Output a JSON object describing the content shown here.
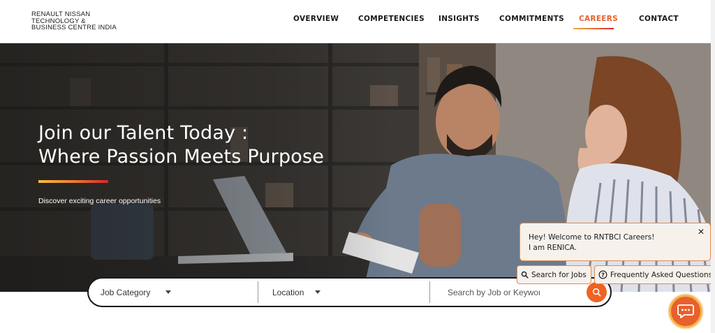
{
  "brand": {
    "line1": "RENAULT NISSAN",
    "line2": "TECHNOLOGY &",
    "line3": "BUSINESS CENTRE INDIA"
  },
  "nav": {
    "items": [
      {
        "label": "OVERVIEW"
      },
      {
        "label": "COMPETENCIES"
      },
      {
        "label": "INSIGHTS"
      },
      {
        "label": "COMMITMENTS"
      },
      {
        "label": "CAREERS",
        "active": true
      },
      {
        "label": "CONTACT"
      }
    ]
  },
  "hero": {
    "title_line1": "Join our Talent Today :",
    "title_line2": "Where Passion Meets Purpose",
    "subtitle": "Discover exciting career opportunities"
  },
  "search": {
    "category_label": "Job Category",
    "location_label": "Location",
    "keyword_placeholder": "Search by Job or Keyword",
    "button_icon": "search-icon"
  },
  "chat": {
    "message_line1": "Hey! Welcome to RNTBCI Careers!",
    "message_line2": "I am RENICA.",
    "close_symbol": "✕",
    "chip_jobs": "Search for Jobs",
    "chip_faq": "Frequently Asked Questions",
    "launcher_icon": "chat-icon"
  },
  "colors": {
    "accent": "#e8602c",
    "accent_yellow": "#f3c03f",
    "accent_red": "#d7262c",
    "text_dark": "#1a1a1a"
  }
}
